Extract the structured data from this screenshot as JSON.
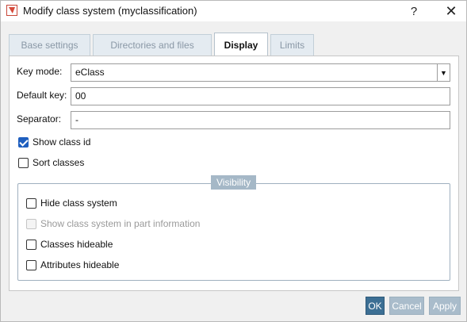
{
  "window": {
    "title": "Modify class system (myclassification)",
    "help_glyph": "?",
    "close_glyph": "✕"
  },
  "tabs": [
    {
      "label": "Base settings",
      "active": false
    },
    {
      "label": "Directories and files",
      "active": false
    },
    {
      "label": "Display",
      "active": true
    },
    {
      "label": "Limits",
      "active": false
    }
  ],
  "display": {
    "key_mode": {
      "label": "Key mode:",
      "value": "eClass"
    },
    "default_key": {
      "label": "Default key:",
      "value": "00"
    },
    "separator": {
      "label": "Separator:",
      "value": "-"
    },
    "show_class_id": {
      "label": "Show class id",
      "checked": true
    },
    "sort_classes": {
      "label": "Sort classes",
      "checked": false
    }
  },
  "visibility": {
    "title": "Visibility",
    "hide_class_system": {
      "label": "Hide class system",
      "checked": false
    },
    "show_in_part_info": {
      "label": "Show class system in part information",
      "checked": false,
      "disabled": true
    },
    "classes_hideable": {
      "label": "Classes hideable",
      "checked": false
    },
    "attributes_hideable": {
      "label": "Attributes hideable",
      "checked": false
    }
  },
  "buttons": {
    "ok": "OK",
    "cancel": "Cancel",
    "apply": "Apply"
  },
  "colors": {
    "accent": "#3c6f94",
    "checkbox_checked": "#1f5fbf",
    "group_title_bg": "#a5b8c7"
  }
}
